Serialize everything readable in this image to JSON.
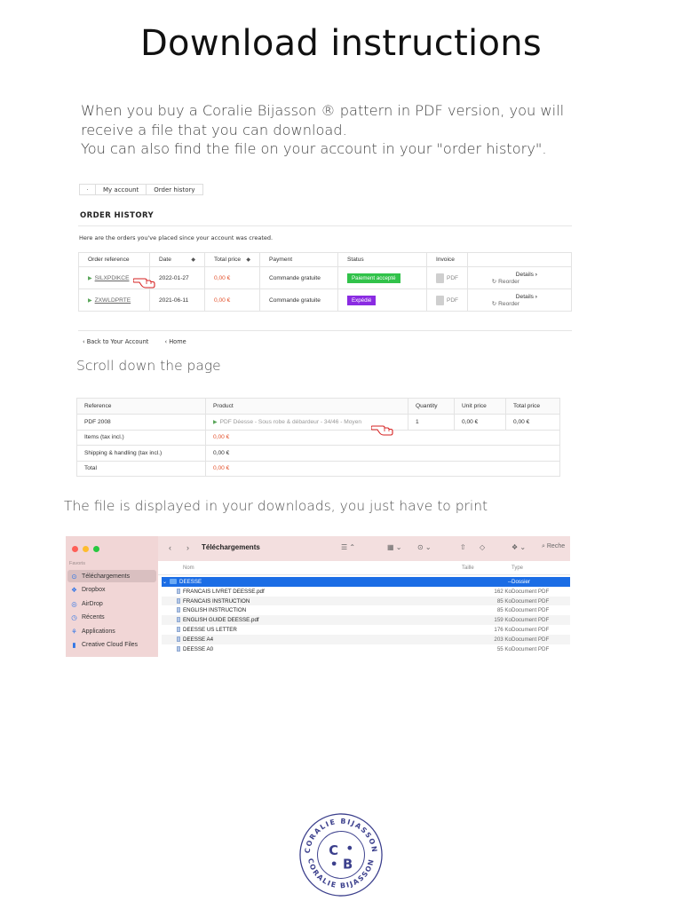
{
  "title": "Download instructions",
  "intro": {
    "line1": "When you buy a Coralie Bijasson ® pattern in PDF version, you will",
    "line2": "receive a file that you can download.",
    "line3": "You can also find the file on your account in your \"order history\"."
  },
  "breadcrumb": {
    "items": [
      "My account",
      "Order history"
    ]
  },
  "order_history": {
    "title": "ORDER HISTORY",
    "subtitle": "Here are the orders you've placed since your account was created.",
    "columns": [
      "Order reference",
      "Date",
      "Total price",
      "Payment",
      "Status",
      "Invoice",
      ""
    ],
    "rows": [
      {
        "ref": "SILXPDIKCE",
        "date": "2022-01-27",
        "price": "0,00 €",
        "payment": "Commande gratuite",
        "status": "Paiement accepté",
        "invoice": "PDF",
        "details": "Details",
        "reorder": "Reorder"
      },
      {
        "ref": "ZXWLDPRTE",
        "date": "2021-06-11",
        "price": "0,00 €",
        "payment": "Commande gratuite",
        "status": "Expédié",
        "invoice": "PDF",
        "details": "Details",
        "reorder": "Reorder"
      }
    ],
    "back_account": "Back to Your Account",
    "home": "Home"
  },
  "scroll_text": "Scroll down the page",
  "products": {
    "columns": [
      "Reference",
      "Product",
      "Quantity",
      "Unit price",
      "Total price"
    ],
    "row": {
      "ref": "PDF 2008",
      "product": "PDF Déesse - Sous robe & débardeur - 34/46 - Moyen",
      "qty": "1",
      "unit": "0,00 €",
      "total": "0,00 €"
    },
    "summary": [
      {
        "label": "Items (tax incl.)",
        "value": "0,00 €"
      },
      {
        "label": "Shipping & handling (tax incl.)",
        "value": "0,00 €"
      },
      {
        "label": "Total",
        "value": "0,00 €"
      }
    ]
  },
  "downloads_text": "The file is displayed in your downloads, you just have to print",
  "finder": {
    "title": "Téléchargements",
    "search_placeholder": "Reche",
    "sidebar_heading": "Favoris",
    "sidebar": [
      "Téléchargements",
      "Dropbox",
      "AirDrop",
      "Récents",
      "Applications",
      "Creative Cloud Files"
    ],
    "columns": {
      "name": "Nom",
      "size": "Taille",
      "type": "Type"
    },
    "folder": {
      "name": "DEESSE",
      "size": "--",
      "type": "Dossier"
    },
    "files": [
      {
        "name": "FRANCAIS LIVRET DEESSE.pdf",
        "size": "162 Ko",
        "type": "Document PDF"
      },
      {
        "name": "FRANCAIS INSTRUCTION",
        "size": "85 Ko",
        "type": "Document PDF"
      },
      {
        "name": "ENGLISH INSTRUCTION",
        "size": "85 Ko",
        "type": "Document PDF"
      },
      {
        "name": "ENGLISH GUIDE DEESSE.pdf",
        "size": "159 Ko",
        "type": "Document PDF"
      },
      {
        "name": "DEESSE US LETTER",
        "size": "176 Ko",
        "type": "Document PDF"
      },
      {
        "name": "DEESSE A4",
        "size": "203 Ko",
        "type": "Document PDF"
      },
      {
        "name": "DEESSE A0",
        "size": "55 Ko",
        "type": "Document PDF"
      }
    ]
  },
  "logo": {
    "ring_text": "CORALIE BIJASSON",
    "letters": [
      "C",
      "B"
    ],
    "color": "#3b3f8c"
  }
}
